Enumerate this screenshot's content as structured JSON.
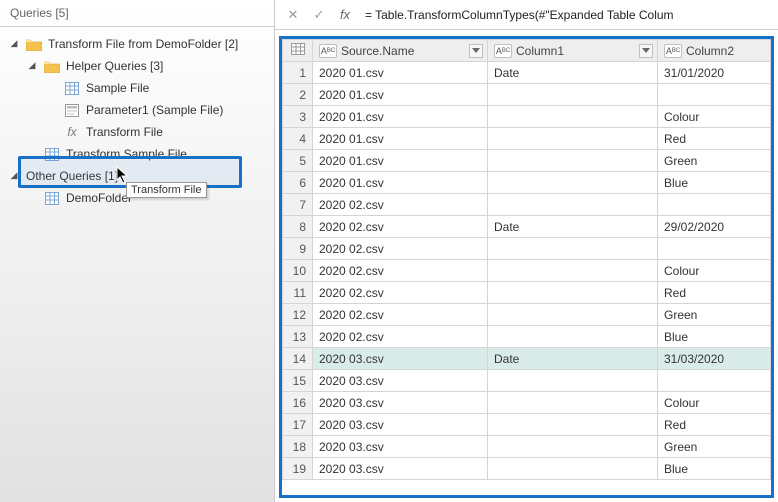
{
  "pane": {
    "title": "Queries [5]",
    "tree": {
      "folder_transform": "Transform File from DemoFolder [2]",
      "folder_helper": "Helper Queries [3]",
      "item_sample_file": "Sample File",
      "item_parameter1": "Parameter1 (Sample File)",
      "item_transform_file_fn": "Transform File",
      "item_transform_sample": "Transform Sample File",
      "folder_other": "Other Queries [1]",
      "item_demofolder": "DemoFolder",
      "tooltip_hover": "Transform File"
    }
  },
  "formula_bar": {
    "text": "= Table.TransformColumnTypes(#\"Expanded Table Colum"
  },
  "grid": {
    "columns": {
      "source_name": "Source.Name",
      "column1": "Column1",
      "column2": "Column2"
    },
    "type_label": "A_C^B",
    "rows": [
      {
        "n": 1,
        "src": "2020 01.csv",
        "c1": "Date",
        "c2": "31/01/2020",
        "sel": false
      },
      {
        "n": 2,
        "src": "2020 01.csv",
        "c1": "",
        "c2": "",
        "sel": false
      },
      {
        "n": 3,
        "src": "2020 01.csv",
        "c1": "",
        "c2": "Colour",
        "sel": false
      },
      {
        "n": 4,
        "src": "2020 01.csv",
        "c1": "",
        "c2": "Red",
        "sel": false
      },
      {
        "n": 5,
        "src": "2020 01.csv",
        "c1": "",
        "c2": "Green",
        "sel": false
      },
      {
        "n": 6,
        "src": "2020 01.csv",
        "c1": "",
        "c2": "Blue",
        "sel": false
      },
      {
        "n": 7,
        "src": "2020 02.csv",
        "c1": "",
        "c2": "",
        "sel": false
      },
      {
        "n": 8,
        "src": "2020 02.csv",
        "c1": "Date",
        "c2": "29/02/2020",
        "sel": false
      },
      {
        "n": 9,
        "src": "2020 02.csv",
        "c1": "",
        "c2": "",
        "sel": false
      },
      {
        "n": 10,
        "src": "2020 02.csv",
        "c1": "",
        "c2": "Colour",
        "sel": false
      },
      {
        "n": 11,
        "src": "2020 02.csv",
        "c1": "",
        "c2": "Red",
        "sel": false
      },
      {
        "n": 12,
        "src": "2020 02.csv",
        "c1": "",
        "c2": "Green",
        "sel": false
      },
      {
        "n": 13,
        "src": "2020 02.csv",
        "c1": "",
        "c2": "Blue",
        "sel": false
      },
      {
        "n": 14,
        "src": "2020 03.csv",
        "c1": "Date",
        "c2": "31/03/2020",
        "sel": true
      },
      {
        "n": 15,
        "src": "2020 03.csv",
        "c1": "",
        "c2": "",
        "sel": false
      },
      {
        "n": 16,
        "src": "2020 03.csv",
        "c1": "",
        "c2": "Colour",
        "sel": false
      },
      {
        "n": 17,
        "src": "2020 03.csv",
        "c1": "",
        "c2": "Red",
        "sel": false
      },
      {
        "n": 18,
        "src": "2020 03.csv",
        "c1": "",
        "c2": "Green",
        "sel": false
      },
      {
        "n": 19,
        "src": "2020 03.csv",
        "c1": "",
        "c2": "Blue",
        "sel": false
      }
    ]
  }
}
